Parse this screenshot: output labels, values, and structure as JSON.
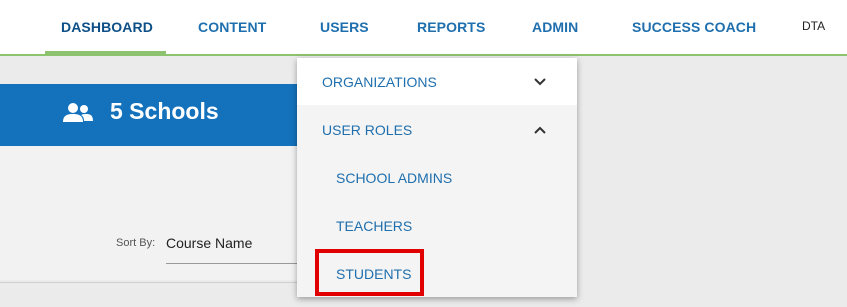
{
  "nav": {
    "items": [
      {
        "label": "DASHBOARD"
      },
      {
        "label": "CONTENT"
      },
      {
        "label": "USERS"
      },
      {
        "label": "REPORTS"
      },
      {
        "label": "ADMIN"
      },
      {
        "label": "SUCCESS COACH"
      }
    ],
    "user": "DTA",
    "active_index": 0
  },
  "banner": {
    "icon": "users-icon",
    "label": "5 Schools"
  },
  "sort": {
    "label": "Sort By:",
    "value": "Course Name"
  },
  "users_menu": {
    "items": [
      {
        "label": "ORGANIZATIONS",
        "chevron": "chevron-down-icon"
      },
      {
        "label": "USER ROLES",
        "chevron": "chevron-up-icon"
      },
      {
        "label": "SCHOOL ADMINS"
      },
      {
        "label": "TEACHERS"
      },
      {
        "label": "STUDENTS"
      }
    ]
  },
  "colors": {
    "accent_green": "#8dc26f",
    "banner_blue": "#1472bd",
    "link_blue": "#1f6fae",
    "highlight_red": "#e00000"
  }
}
